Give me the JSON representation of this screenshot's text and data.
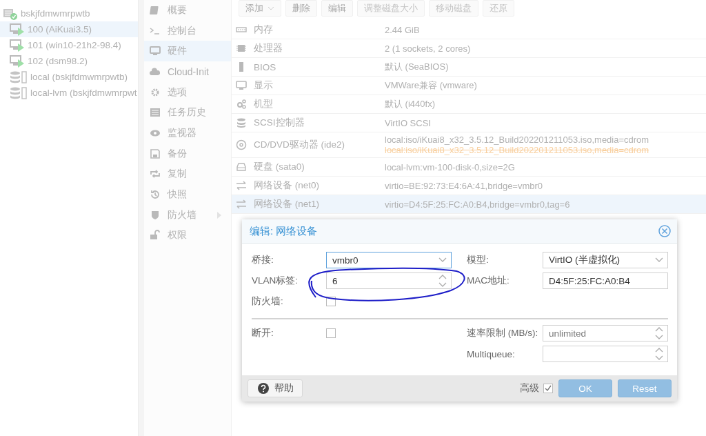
{
  "tree": {
    "label": "bskjfdmwmrpwtb",
    "children": [
      {
        "label": "100 (AiKuai3.5)",
        "kind": "vm",
        "selected": true
      },
      {
        "label": "101 (win10-21h2-98.4)",
        "kind": "vm",
        "selected": false
      },
      {
        "label": "102 (dsm98.2)",
        "kind": "vm",
        "selected": false
      },
      {
        "label": "local (bskjfdmwmrpwtb)",
        "kind": "storage",
        "selected": false
      },
      {
        "label": "local-lvm (bskjfdmwmrpwt",
        "kind": "storage",
        "selected": false
      }
    ]
  },
  "nav": [
    {
      "label": "概要",
      "selected": false,
      "expandable": false
    },
    {
      "label": "控制台",
      "selected": false,
      "expandable": false
    },
    {
      "label": "硬件",
      "selected": true,
      "expandable": false
    },
    {
      "label": "Cloud-Init",
      "selected": false,
      "expandable": false
    },
    {
      "label": "选项",
      "selected": false,
      "expandable": false
    },
    {
      "label": "任务历史",
      "selected": false,
      "expandable": false
    },
    {
      "label": "监视器",
      "selected": false,
      "expandable": false
    },
    {
      "label": "备份",
      "selected": false,
      "expandable": false
    },
    {
      "label": "复制",
      "selected": false,
      "expandable": false
    },
    {
      "label": "快照",
      "selected": false,
      "expandable": false
    },
    {
      "label": "防火墙",
      "selected": false,
      "expandable": true
    },
    {
      "label": "权限",
      "selected": false,
      "expandable": false
    }
  ],
  "toolbar": [
    {
      "label": "添加",
      "dropdown": true,
      "disabled": false
    },
    {
      "label": "删除",
      "dropdown": false,
      "disabled": false
    },
    {
      "label": "编辑",
      "dropdown": false,
      "disabled": false
    },
    {
      "label": "调整磁盘大小",
      "dropdown": false,
      "disabled": true
    },
    {
      "label": "移动磁盘",
      "dropdown": false,
      "disabled": true
    },
    {
      "label": "还原",
      "dropdown": false,
      "disabled": true
    }
  ],
  "hardware": [
    {
      "name": "内存",
      "value": "2.44 GiB",
      "selected": false
    },
    {
      "name": "处理器",
      "value": "2 (1 sockets, 2 cores)",
      "selected": false
    },
    {
      "name": "BIOS",
      "value": "默认 (SeaBIOS)",
      "selected": false
    },
    {
      "name": "显示",
      "value": "VMWare兼容 (vmware)",
      "selected": false
    },
    {
      "name": "机型",
      "value": "默认 (i440fx)",
      "selected": false
    },
    {
      "name": "SCSI控制器",
      "value": "VirtIO SCSI",
      "selected": false
    },
    {
      "name": "CD/DVD驱动器 (ide2)",
      "value": "local:iso/iKuai8_x32_3.5.12_Build202201211053.iso,media=cdrom",
      "pending_value": "local:iso/iKuai8_x32_3.5.12_Build202201211053.iso,media=cdrom",
      "selected": false
    },
    {
      "name": "硬盘 (sata0)",
      "value": "local-lvm:vm-100-disk-0,size=2G",
      "selected": false
    },
    {
      "name": "网络设备 (net0)",
      "value": "virtio=BE:92:73:E4:6A:41,bridge=vmbr0",
      "selected": false
    },
    {
      "name": "网络设备 (net1)",
      "value": "virtio=D4:5F:25:FC:A0:B4,bridge=vmbr0,tag=6",
      "selected": true
    }
  ],
  "dialog": {
    "title": "编辑: 网络设备",
    "left": [
      {
        "label": "桥接:",
        "kind": "combo",
        "value": "vmbr0",
        "focused": true
      },
      {
        "label": "VLAN标签:",
        "kind": "spinner",
        "value": "6",
        "focused": false
      },
      {
        "label": "防火墙:",
        "kind": "checkbox",
        "checked": false
      }
    ],
    "right": [
      {
        "label": "模型:",
        "kind": "combo",
        "value": "VirtIO (半虚拟化)",
        "focused": false
      },
      {
        "label": "MAC地址:",
        "kind": "text",
        "value": "D4:5F:25:FC:A0:B4",
        "focused": false
      }
    ],
    "advanced_left": [
      {
        "label": "断开:",
        "kind": "checkbox",
        "checked": false
      }
    ],
    "advanced_right": [
      {
        "label": "速率限制 (MB/s):",
        "kind": "spinner",
        "placeholder": "unlimited",
        "focused": false
      },
      {
        "label": "Multiqueue:",
        "kind": "spinner",
        "focused": false
      }
    ],
    "help": "帮助",
    "advanced": {
      "label": "高级",
      "checked": true
    },
    "buttons": [
      "OK",
      "Reset"
    ]
  }
}
